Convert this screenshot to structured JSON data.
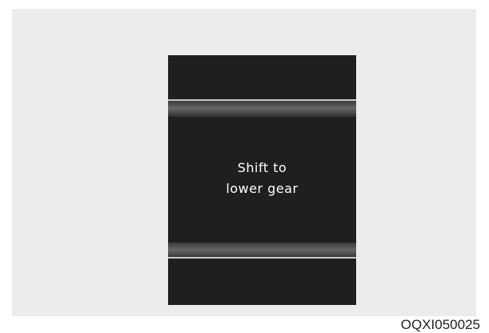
{
  "display": {
    "message_line1": "Shift to",
    "message_line2": "lower gear"
  },
  "figure_code": "OQXI050025",
  "colors": {
    "panel_background": "#ececec",
    "display_background": "#1f1f1f",
    "text": "#ffffff"
  }
}
